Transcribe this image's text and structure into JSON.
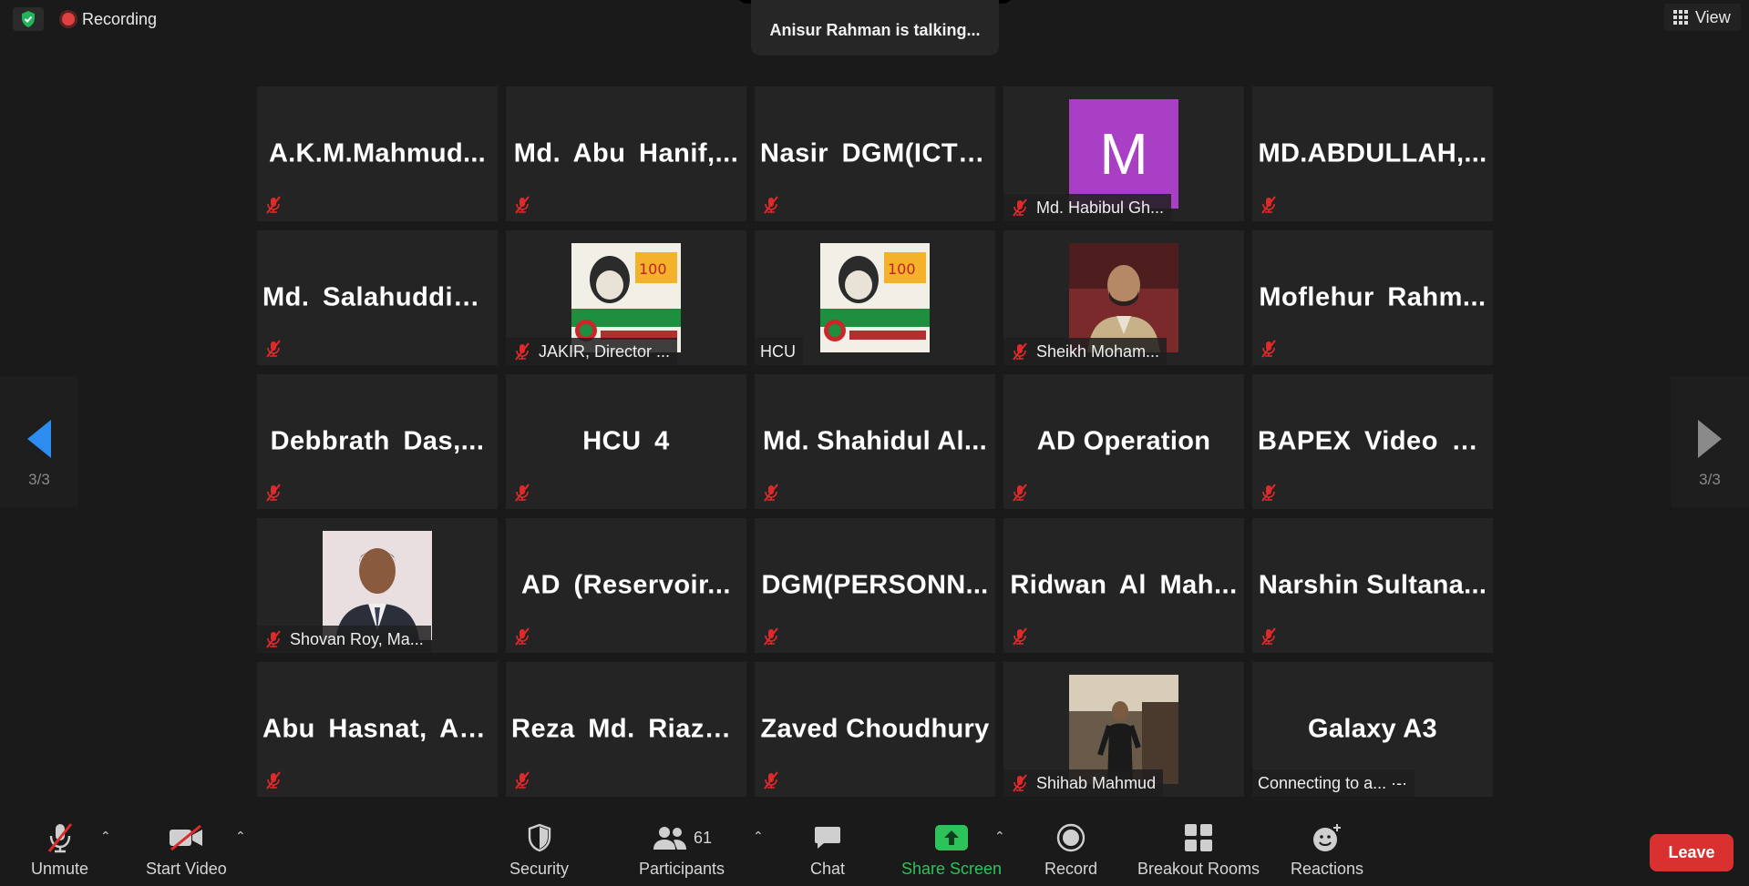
{
  "top": {
    "recording_label": "Recording",
    "talking": "Anisur Rahman is talking...",
    "view_label": "View"
  },
  "nav": {
    "left_page": "3/3",
    "right_page": "3/3"
  },
  "tiles": [
    {
      "name": "A.K.M.Mahmud..."
    },
    {
      "name": "Md. Abu Hanif,..."
    },
    {
      "name": "Nasir DGM(ICT)..."
    },
    {
      "label": "Md. Habibul Gh...",
      "avatar_letter": "M",
      "avatar_color": "#a93fc4"
    },
    {
      "name": "MD.ABDULLAH,..."
    },
    {
      "name": "Md. Salahuddin..."
    },
    {
      "label": "JAKIR, Director ..."
    },
    {
      "label": "HCU"
    },
    {
      "label": "Sheikh Moham..."
    },
    {
      "name": "Moflehur Rahm..."
    },
    {
      "name": "Debbrath Das,..."
    },
    {
      "name": "HCU 4"
    },
    {
      "name": "Md. Shahidul Al..."
    },
    {
      "name": "AD Operation"
    },
    {
      "name": "BAPEX Video C..."
    },
    {
      "label": "Shovan Roy, Ma..."
    },
    {
      "name": "AD (Reservoir..."
    },
    {
      "name": "DGM(PERSONN..."
    },
    {
      "name": "Ridwan Al Mah..."
    },
    {
      "name": "Narshin Sultana..."
    },
    {
      "name": "Abu Hasnat, AG..."
    },
    {
      "name": "Reza Md. Riazu..."
    },
    {
      "name": "Zaved Choudhury"
    },
    {
      "label": "Shihab Mahmud"
    },
    {
      "name": "Galaxy A3",
      "label": "Connecting to a... ·-·"
    }
  ],
  "toolbar": {
    "unmute": "Unmute",
    "start_video": "Start Video",
    "security": "Security",
    "participants": "Participants",
    "participants_count": "61",
    "chat": "Chat",
    "share_screen": "Share Screen",
    "record": "Record",
    "breakout_rooms": "Breakout Rooms",
    "reactions": "Reactions",
    "leave": "Leave"
  },
  "colors": {
    "accent_blue": "#2d8cf0",
    "share_green": "#2ec25a",
    "leave_red": "#d8312f",
    "mute_red": "#e02a2a"
  }
}
